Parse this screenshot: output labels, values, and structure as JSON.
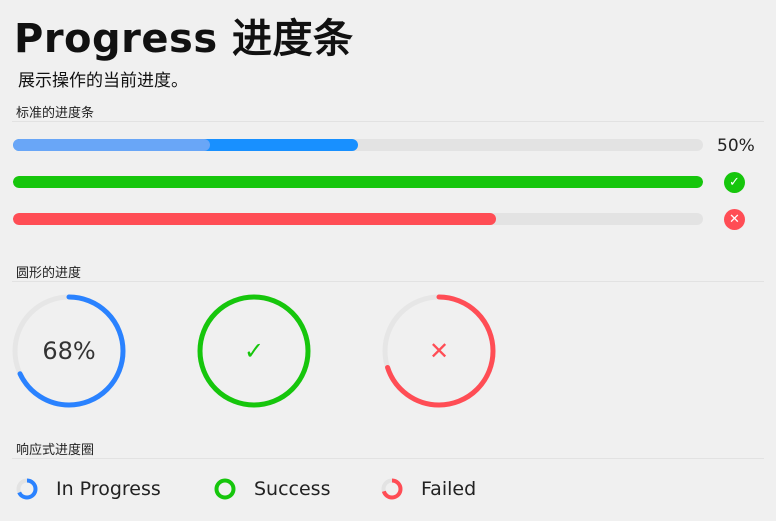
{
  "page": {
    "title": "Progress 进度条",
    "subtitle": "展示操作的当前进度。"
  },
  "sections": {
    "standard": "标准的进度条",
    "circle": "圆形的进度",
    "responsive": "响应式进度圈"
  },
  "bars": [
    {
      "value": 0.5,
      "secondary_value": 0.285,
      "text": "50%",
      "status": "normal",
      "color": "#1890ff",
      "secondary_color": "#69a6f7"
    },
    {
      "value": 1.0,
      "status": "success",
      "color": "#16c60c",
      "icon": "check-icon"
    },
    {
      "value": 0.7,
      "status": "exception",
      "color": "#ff4d55",
      "icon": "close-icon"
    }
  ],
  "circles": [
    {
      "value": 0.68,
      "text": "68%",
      "status": "normal",
      "color": "#2a82ff",
      "track_color": "#e6e6e6"
    },
    {
      "value": 1.0,
      "text": "✓",
      "status": "success",
      "color": "#16c60c",
      "icon": "check-icon"
    },
    {
      "value": 0.7,
      "text": "✕",
      "status": "exception",
      "color": "#ff4d55",
      "icon": "close-icon"
    }
  ],
  "responsive": [
    {
      "label": "In Progress",
      "value": 0.68,
      "color": "#2a82ff",
      "icon": "progress-ring-icon"
    },
    {
      "label": "Success",
      "value": 1.0,
      "color": "#16c60c",
      "icon": "success-ring-icon"
    },
    {
      "label": "Failed",
      "value": 0.7,
      "color": "#ff4d55",
      "icon": "failed-ring-icon"
    }
  ]
}
